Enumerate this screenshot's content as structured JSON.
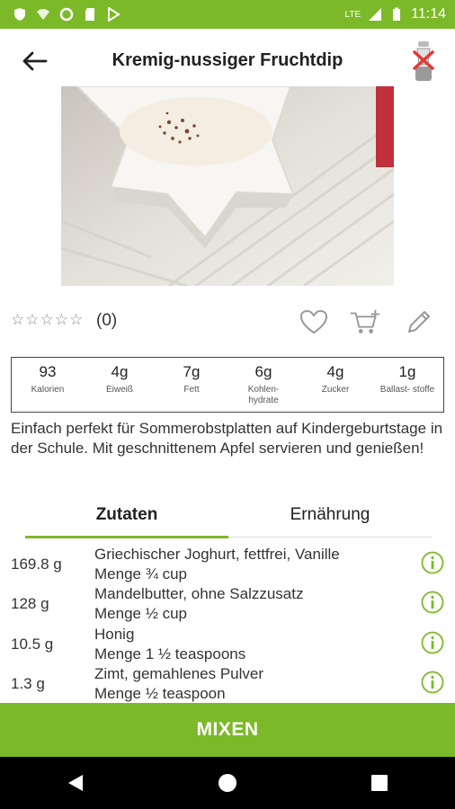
{
  "status_bar": {
    "time": "11:14",
    "network": "LTE",
    "icons": [
      "shield-icon",
      "wifi-icon",
      "sync-icon",
      "sd-card-icon",
      "play-store-icon",
      "signal-icon",
      "battery-icon"
    ]
  },
  "header": {
    "title": "Kremig-nussiger Fruchtdip",
    "back_icon": "arrow-left-icon",
    "mixer_icon": "mixer-disconnected-icon"
  },
  "rating": {
    "stars": "☆☆☆☆☆",
    "count": "(0)",
    "actions": [
      "heart-icon",
      "add-to-cart-icon",
      "edit-pencil-icon"
    ]
  },
  "nutrition": [
    {
      "value": "93",
      "label": "Kalorien"
    },
    {
      "value": "4g",
      "label": "Eiweiß"
    },
    {
      "value": "7g",
      "label": "Fett"
    },
    {
      "value": "6g",
      "label": "Kohlen- hydrate"
    },
    {
      "value": "4g",
      "label": "Zucker"
    },
    {
      "value": "1g",
      "label": "Ballast- stoffe"
    }
  ],
  "description": "Einfach perfekt für Sommerobstplatten auf Kindergeburtstage in der Schule. Mit geschnittenem Apfel servieren und genießen!",
  "tabs": [
    {
      "label": "Zutaten",
      "active": true
    },
    {
      "label": "Ernährung",
      "active": false
    }
  ],
  "ingredients": [
    {
      "qty": "169.8 g",
      "name": "Griechischer Joghurt, fettfrei, Vanille",
      "amount": "Menge ¾ cup"
    },
    {
      "qty": "128 g",
      "name": "Mandelbutter, ohne Salzzusatz",
      "amount": "Menge ½ cup"
    },
    {
      "qty": "10.5 g",
      "name": "Honig",
      "amount": "Menge 1 ½ teaspoons"
    },
    {
      "qty": "1.3 g",
      "name": "Zimt, gemahlenes Pulver",
      "amount": "Menge ½ teaspoon"
    }
  ],
  "primary_button": {
    "label": "MIXEN"
  },
  "colors": {
    "accent": "#7cb928",
    "nav_bg": "#000000"
  },
  "nav_bar": [
    "back-triangle-icon",
    "home-circle-icon",
    "recents-square-icon"
  ]
}
